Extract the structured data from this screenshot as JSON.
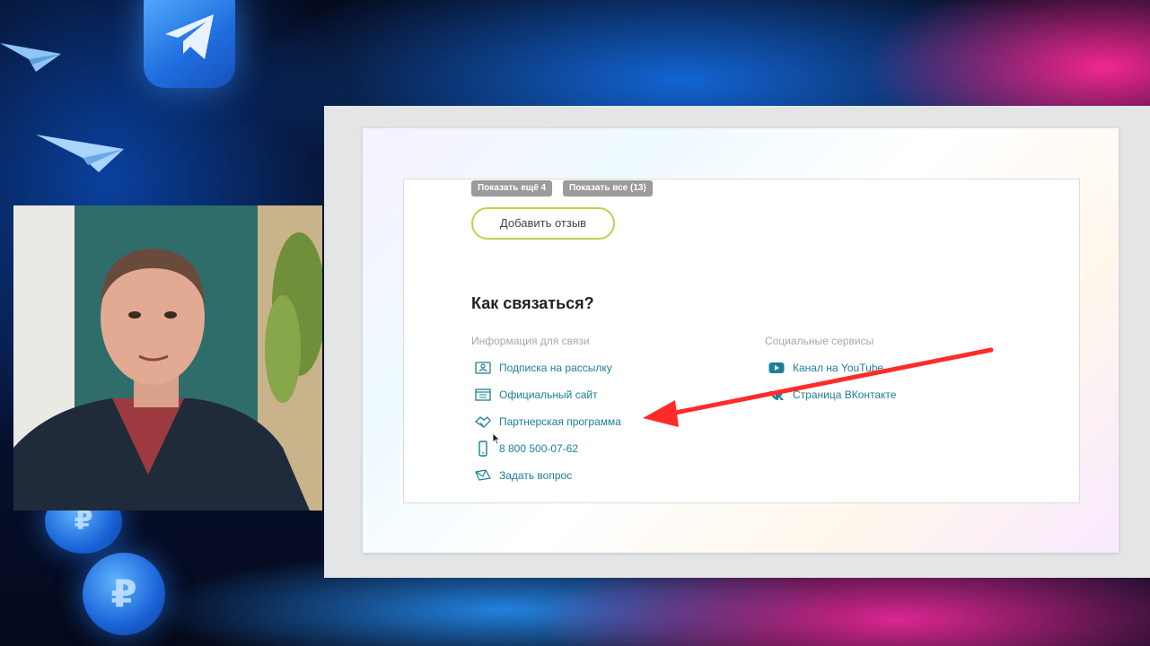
{
  "reviews": {
    "show_more_label": "Показать ещё 4",
    "show_all_label": "Показать все (13)",
    "add_review_label": "Добавить отзыв"
  },
  "contact": {
    "title": "Как связаться?",
    "info_heading": "Информация для связи",
    "social_heading": "Социальные сервисы",
    "info_links": [
      {
        "icon": "newsletter-icon",
        "label": "Подписка на рассылку"
      },
      {
        "icon": "website-icon",
        "label": "Официальный сайт"
      },
      {
        "icon": "handshake-icon",
        "label": "Партнерская программа"
      },
      {
        "icon": "phone-icon",
        "label": "8 800 500-07-62"
      },
      {
        "icon": "envelope-icon",
        "label": "Задать вопрос"
      }
    ],
    "social_links": [
      {
        "icon": "youtube-icon",
        "label": "Канал на YouTube"
      },
      {
        "icon": "vk-icon",
        "label": "Страница ВКонтакте"
      }
    ]
  },
  "annotation": {
    "arrow_color": "#ff2b2b"
  },
  "colors": {
    "link": "#1b7f98",
    "button_border": "#b6d64a",
    "pill": "#9b9b9b"
  }
}
